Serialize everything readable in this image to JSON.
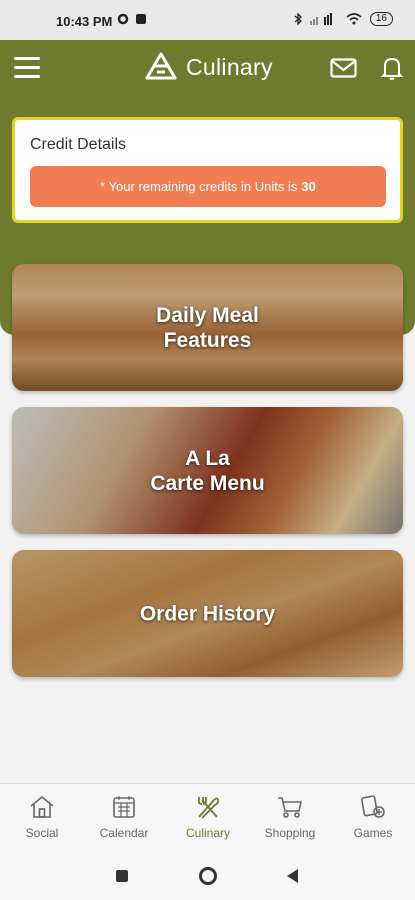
{
  "status_bar": {
    "time": "10:43 PM",
    "icons": [
      "settings-icon",
      "notification-icon",
      "bluetooth-icon",
      "signal-icon",
      "wifi-icon"
    ],
    "battery": "16"
  },
  "appbar": {
    "title": "Culinary",
    "icons": [
      "menu-icon",
      "culinary-logo-icon",
      "mail-icon",
      "bell-icon"
    ]
  },
  "credit": {
    "title": "Credit Details",
    "message": "* Your remaining credits in Units  is",
    "value": "30"
  },
  "cards": [
    {
      "label": "Daily Meal\nFeatures"
    },
    {
      "label": "A La\nCarte Menu"
    },
    {
      "label": "Order History"
    }
  ],
  "bottom_nav": [
    {
      "label": "Social",
      "icon": "home-icon"
    },
    {
      "label": "Calendar",
      "icon": "calendar-icon"
    },
    {
      "label": "Culinary",
      "icon": "utensils-icon",
      "active": true
    },
    {
      "label": "Shopping",
      "icon": "cart-icon"
    },
    {
      "label": "Games",
      "icon": "games-icon"
    }
  ],
  "colors": {
    "header": "#6e7b2e",
    "credit_pill": "#f07e52",
    "credit_border": "#e8d21e",
    "active_nav": "#6e7b2e"
  }
}
